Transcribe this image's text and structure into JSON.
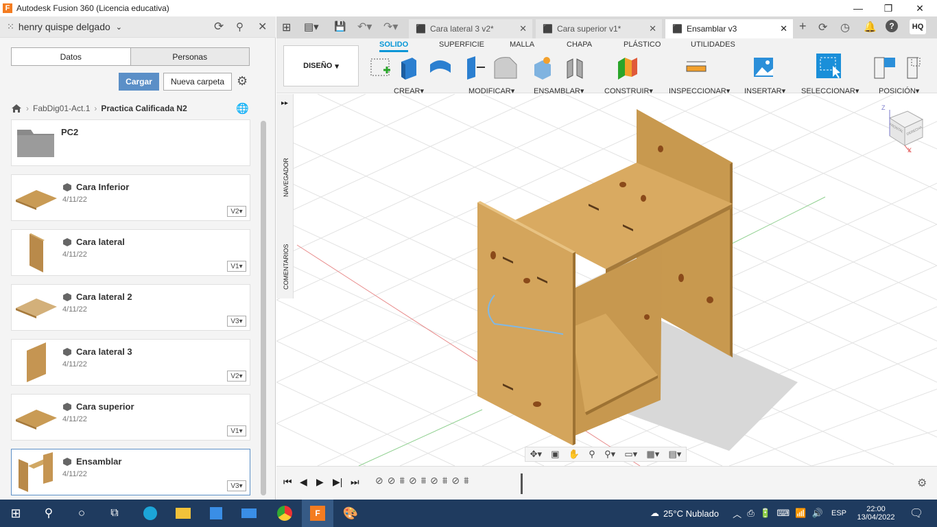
{
  "window": {
    "title": "Autodesk Fusion 360 (Licencia educativa)",
    "logo_letter": "F",
    "min": "—",
    "restore": "❐",
    "close": "✕"
  },
  "panel": {
    "user": "henry quispe delgado",
    "tabs": [
      "Datos",
      "Personas"
    ],
    "upload_label": "Cargar",
    "new_folder_label": "Nueva carpeta",
    "breadcrumb": [
      "FabDig01-Act.1",
      "Practica Calificada N2"
    ],
    "folder": {
      "name": "PC2"
    },
    "files": [
      {
        "name": "Cara Inferior",
        "date": "4/11/22",
        "version": "V2"
      },
      {
        "name": "Cara lateral",
        "date": "4/11/22",
        "version": "V1"
      },
      {
        "name": "Cara lateral 2",
        "date": "4/11/22",
        "version": "V3"
      },
      {
        "name": "Cara lateral 3",
        "date": "4/11/22",
        "version": "V2"
      },
      {
        "name": "Cara superior",
        "date": "4/11/22",
        "version": "V1"
      },
      {
        "name": "Ensamblar",
        "date": "4/11/22",
        "version": "V3"
      }
    ]
  },
  "doc_tabs": [
    {
      "label": "Cara lateral 3 v2*",
      "active": false
    },
    {
      "label": "Cara superior v1*",
      "active": false
    },
    {
      "label": "Ensamblar v3",
      "active": true
    }
  ],
  "user_initials": "HQ",
  "workspace": "DISEÑO",
  "menu_tabs": [
    "SOLIDO",
    "SUPERFICIE",
    "MALLA",
    "CHAPA",
    "PLÁSTICO",
    "UTILIDADES"
  ],
  "tool_groups": [
    "CREAR",
    "MODIFICAR",
    "ENSAMBLAR",
    "CONSTRUIR",
    "INSPECCIONAR",
    "INSERTAR",
    "SELECCIONAR",
    "POSICIÓN"
  ],
  "side_labels": {
    "nav": "NAVEGADOR",
    "comments": "COMENTARIOS"
  },
  "viewcube": {
    "z": "Z",
    "x": "X",
    "front": "FRONTAL",
    "right": "DERECHA"
  },
  "taskbar": {
    "weather": "25°C  Nublado",
    "lang": "ESP",
    "time": "22:00",
    "date": "13/04/2022"
  }
}
